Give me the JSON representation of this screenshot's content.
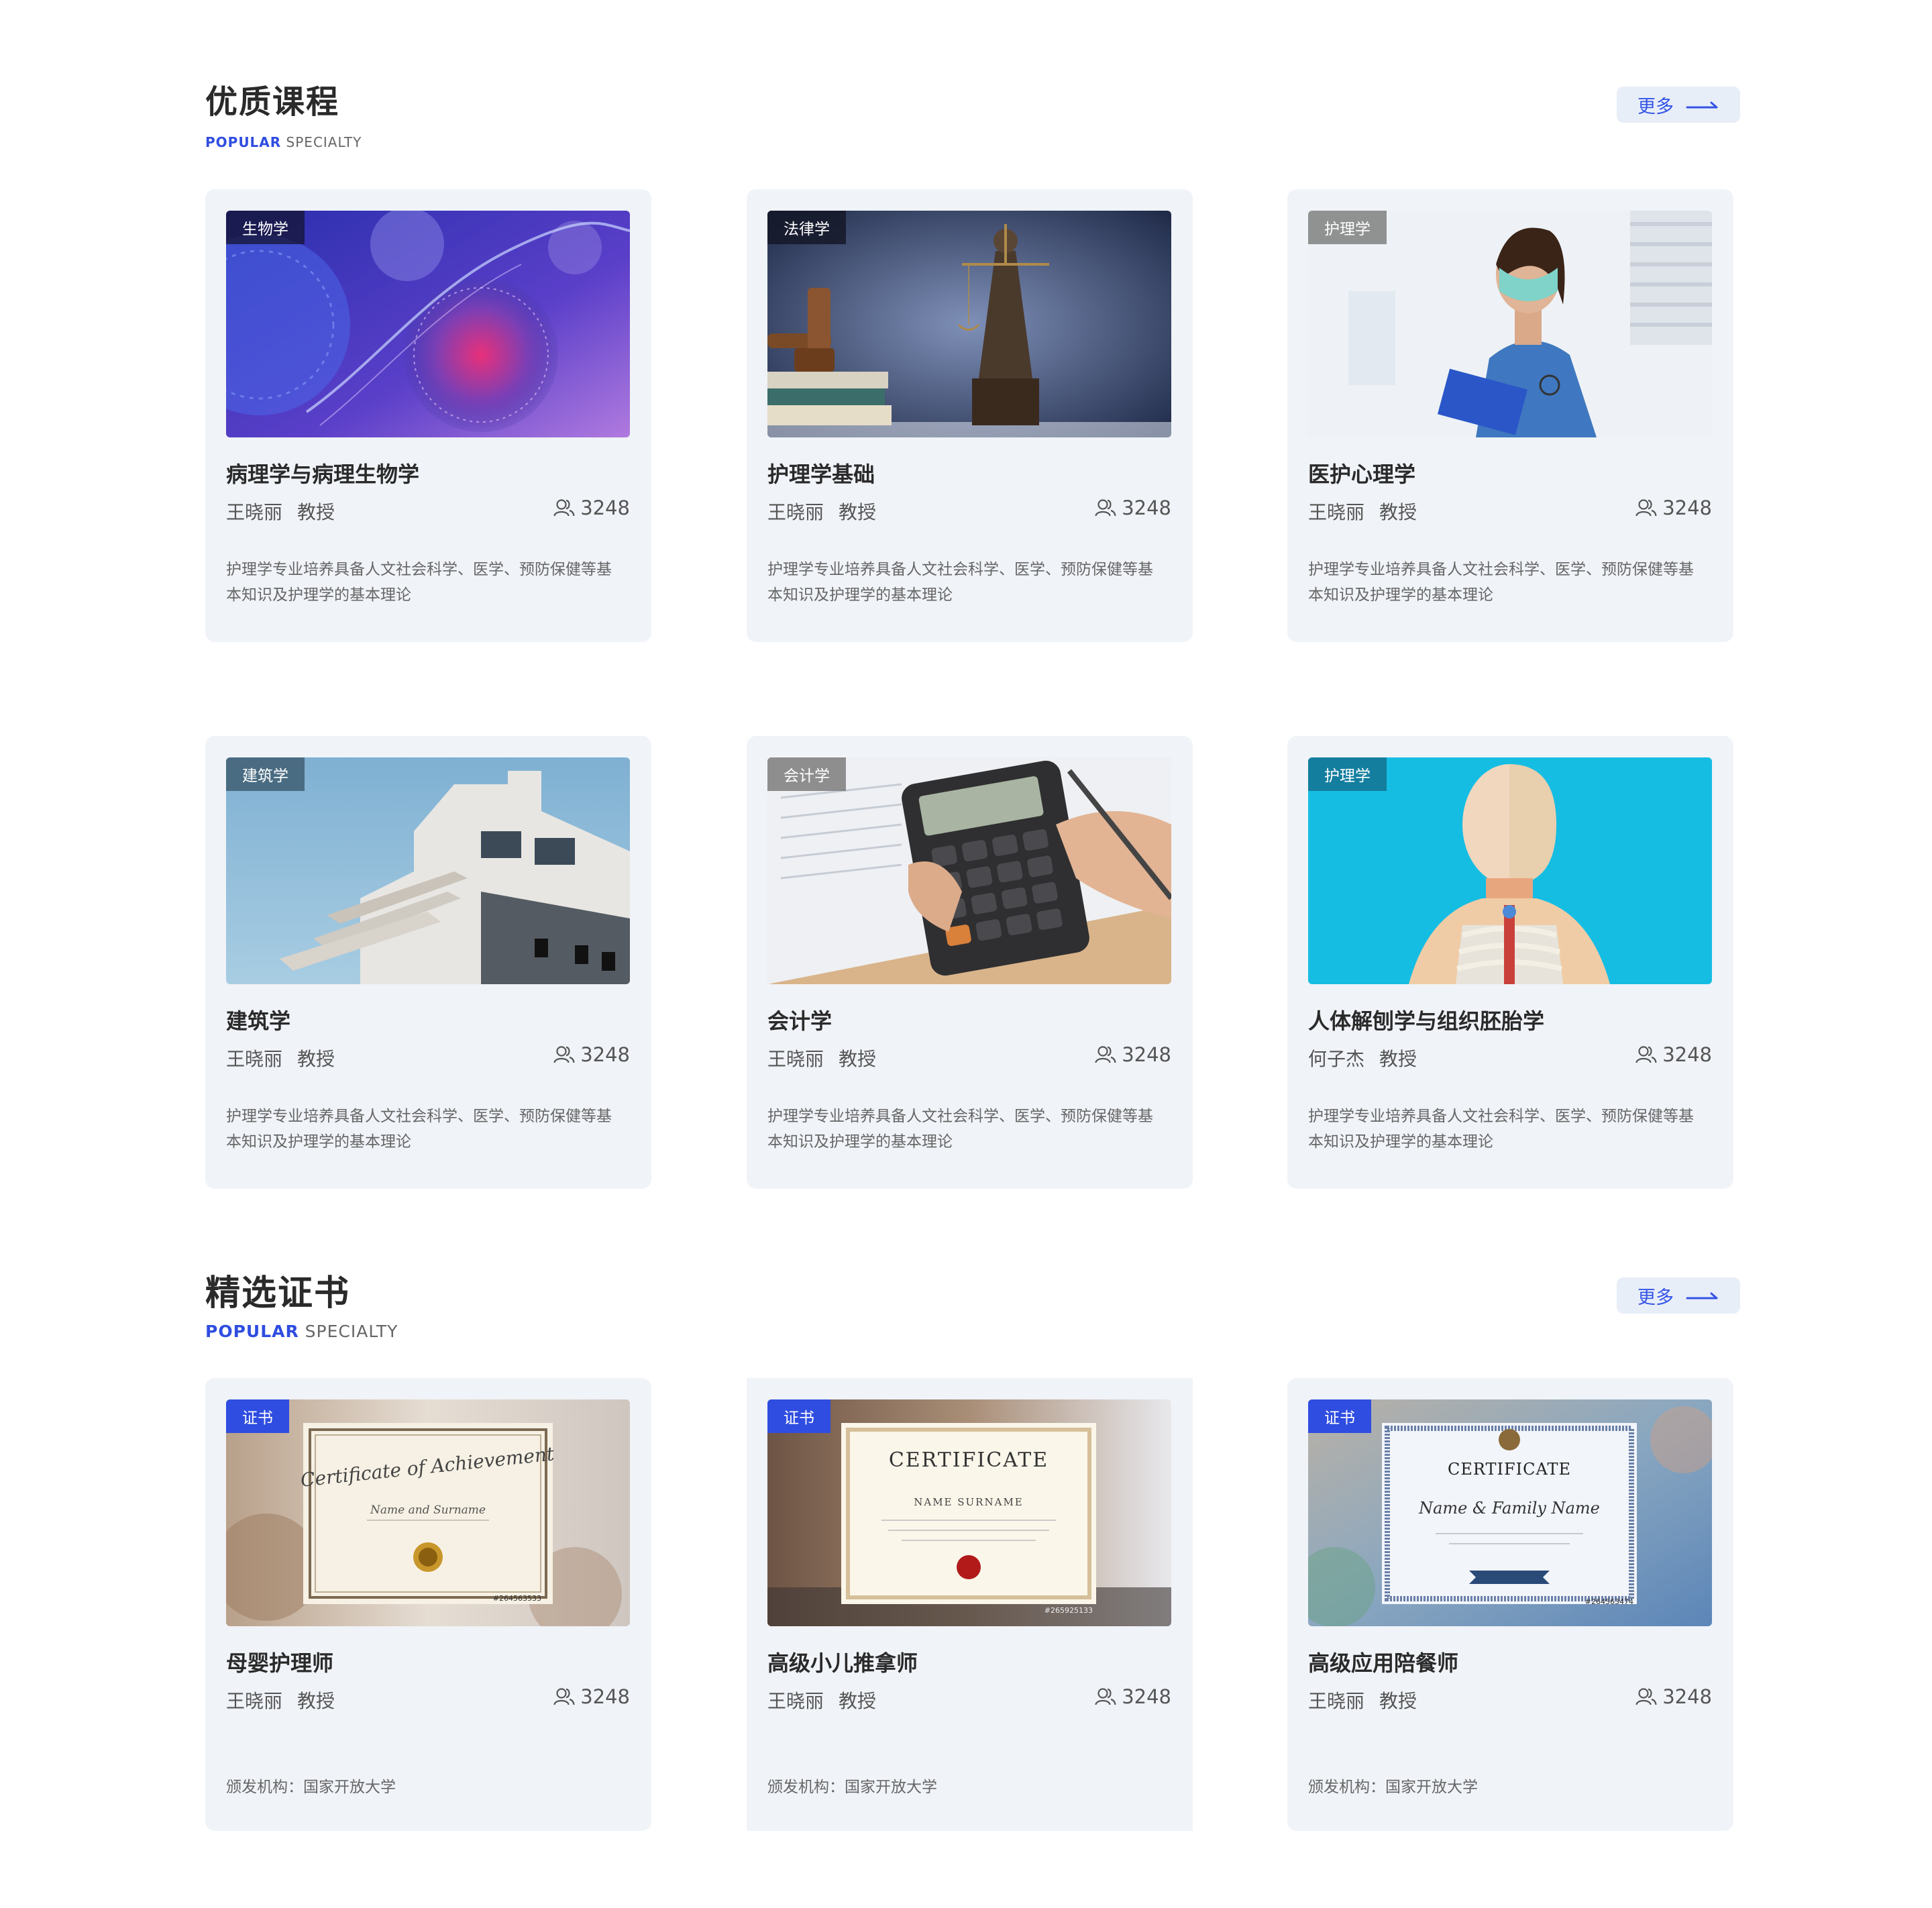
{
  "sections": [
    {
      "title": "优质课程",
      "subtitle_highlight": "POPULAR",
      "subtitle_rest": " SPECIALTY",
      "more_label": "更多",
      "cards": [
        {
          "tag": "生物学",
          "title": "病理学与病理生物学",
          "teacher": "王晓丽",
          "rank": "教授",
          "count": "3248",
          "desc": "护理学专业培养具备人文社会科学、医学、预防保健等基本知识及护理学的基本理论",
          "image": "cell-illustration"
        },
        {
          "tag": "法律学",
          "title": "护理学基础",
          "teacher": "王晓丽",
          "rank": "教授",
          "count": "3248",
          "desc": "护理学专业培养具备人文社会科学、医学、预防保健等基本知识及护理学的基本理论",
          "image": "justice-statue-photo"
        },
        {
          "tag": "护理学",
          "title": "医护心理学",
          "teacher": "王晓丽",
          "rank": "教授",
          "count": "3248",
          "desc": "护理学专业培养具备人文社会科学、医学、预防保健等基本知识及护理学的基本理论",
          "image": "nurse-photo"
        },
        {
          "tag": "建筑学",
          "title": "建筑学",
          "teacher": "王晓丽",
          "rank": "教授",
          "count": "3248",
          "desc": "护理学专业培养具备人文社会科学、医学、预防保健等基本知识及护理学的基本理论",
          "image": "building-photo"
        },
        {
          "tag": "会计学",
          "title": "会计学",
          "teacher": "王晓丽",
          "rank": "教授",
          "count": "3248",
          "desc": "护理学专业培养具备人文社会科学、医学、预防保健等基本知识及护理学的基本理论",
          "image": "calculator-photo"
        },
        {
          "tag": "护理学",
          "title": "人体解刨学与组织胚胎学",
          "teacher": "何子杰",
          "rank": "教授",
          "count": "3248",
          "desc": "护理学专业培养具备人文社会科学、医学、预防保健等基本知识及护理学的基本理论",
          "image": "anatomy-model-photo"
        }
      ]
    },
    {
      "title": "精选证书",
      "subtitle_highlight": "POPULAR",
      "subtitle_rest": " SPECIALTY",
      "more_label": "更多",
      "cards": [
        {
          "tag": "证书",
          "title": "母婴护理师",
          "teacher": "王晓丽",
          "rank": "教授",
          "count": "3248",
          "issuer": "颁发机构：国家开放大学",
          "image": "certificate-photo",
          "cert_heading": "Certificate of Achievement",
          "cert_name": "Name and Surname",
          "cert_id": "#264563533"
        },
        {
          "tag": "证书",
          "title": "高级小儿推拿师",
          "teacher": "王晓丽",
          "rank": "教授",
          "count": "3248",
          "issuer": "颁发机构：国家开放大学",
          "image": "certificate-photo",
          "cert_heading": "CERTIFICATE",
          "cert_name": "NAME SURNAME",
          "cert_id": "#265925133"
        },
        {
          "tag": "证书",
          "title": "高级应用陪餐师",
          "teacher": "王晓丽",
          "rank": "教授",
          "count": "3248",
          "issuer": "颁发机构：国家开放大学",
          "image": "certificate-photo",
          "cert_heading": "CERTIFICATE",
          "cert_name": "Name & Family Name",
          "cert_id": "#264563474"
        }
      ]
    }
  ],
  "colors": {
    "accent": "#2f4de0",
    "card_bg": "#f0f3f8",
    "more_bg": "#e8eef8",
    "tag_cert": "#2f4de0"
  }
}
